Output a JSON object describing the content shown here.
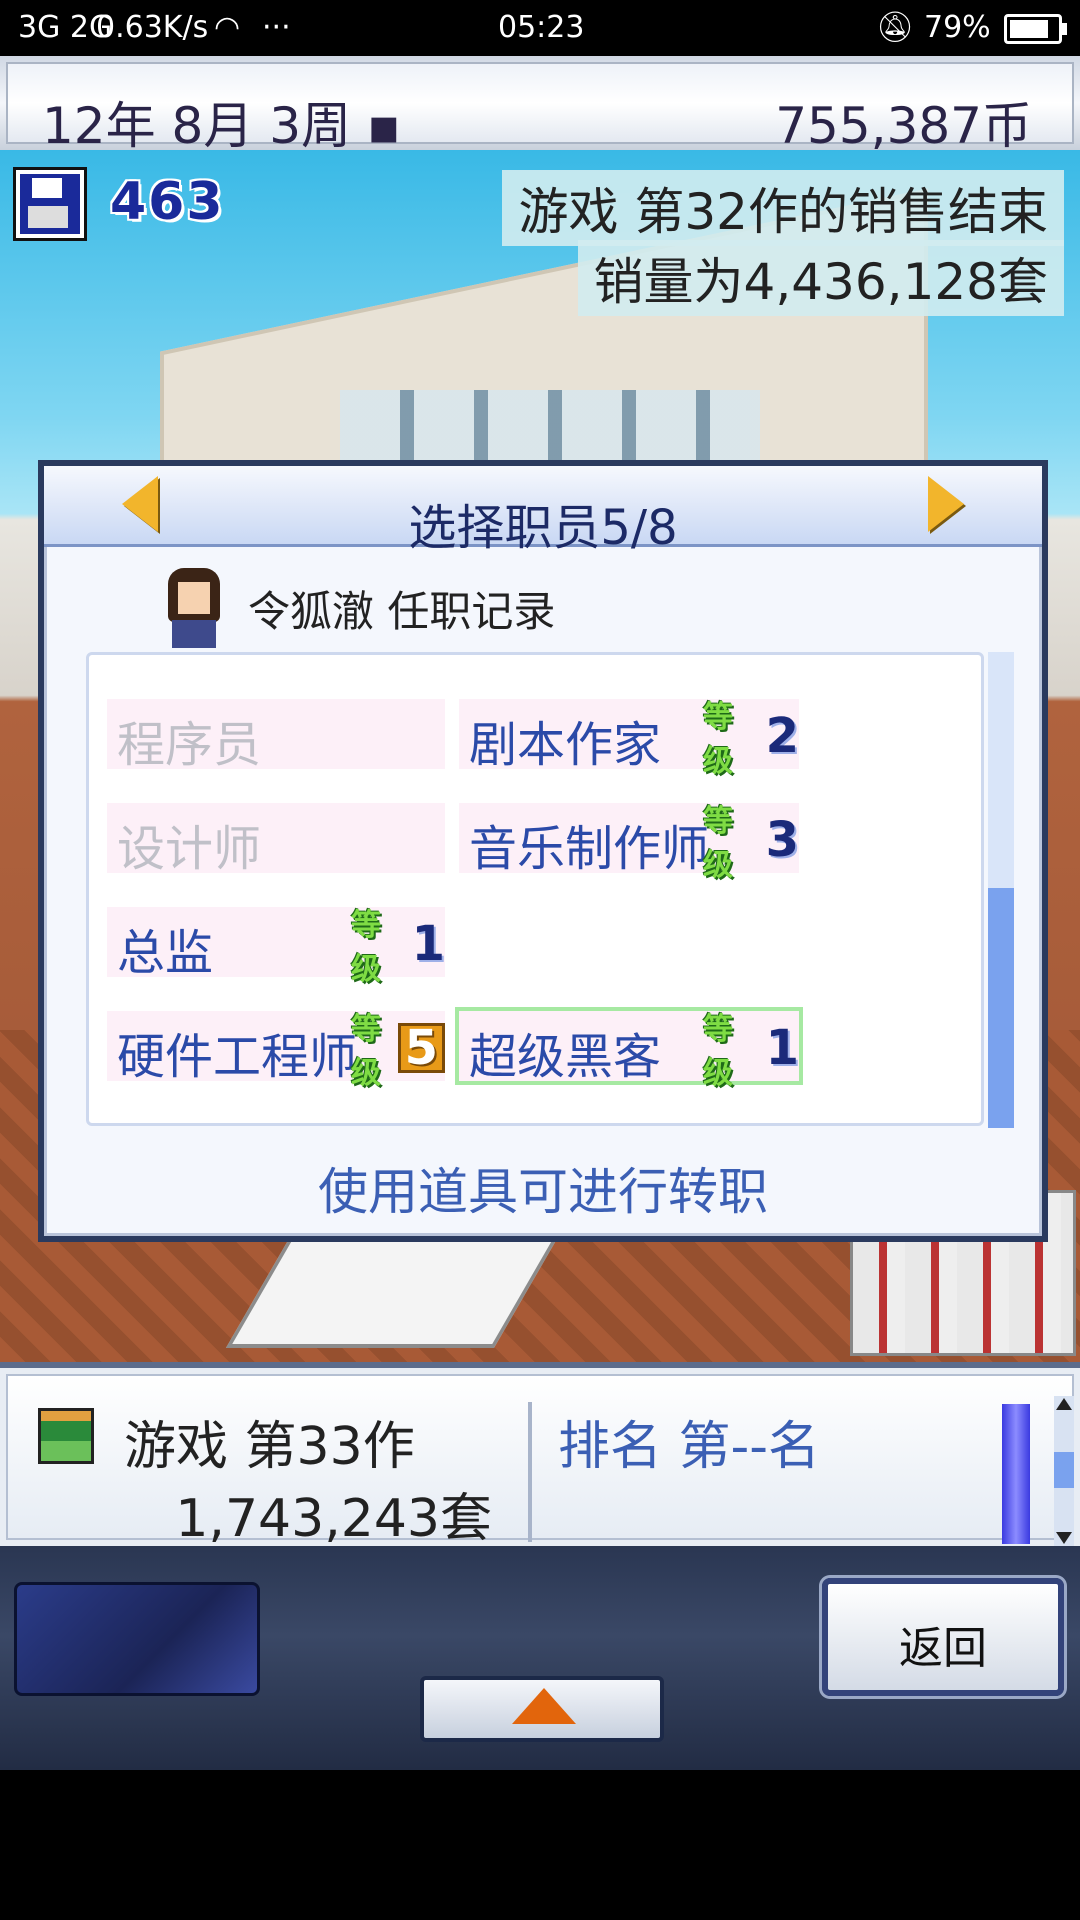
{
  "status_bar": {
    "network": "3G 2G",
    "speed": "0.63K/s",
    "more": "···",
    "time": "05:23",
    "battery": "79%"
  },
  "top_bar": {
    "date": "12年 8月 3周 ▪",
    "money": "755,387币"
  },
  "scene": {
    "save_count": "463",
    "notice_1": "游戏 第32作的销售结束",
    "notice_2": "销量为4,436,128套"
  },
  "dialog": {
    "title": "选择职员5/8",
    "staff_name": "令狐澈 任职记录",
    "level_tag": "等级",
    "jobs": [
      {
        "label": "程序员",
        "unlocked": false,
        "level": ""
      },
      {
        "label": "剧本作家",
        "unlocked": true,
        "level": "2"
      },
      {
        "label": "设计师",
        "unlocked": false,
        "level": ""
      },
      {
        "label": "音乐制作师",
        "unlocked": true,
        "level": "3"
      },
      {
        "label": "总监",
        "unlocked": true,
        "level": "1"
      },
      {
        "label": "硬件工程师",
        "unlocked": true,
        "level": "5"
      },
      {
        "label": "超级黑客",
        "unlocked": true,
        "level": "1",
        "selected": true
      }
    ],
    "hint": "使用道具可进行转职"
  },
  "info_panel": {
    "game_name": "游戏 第33作",
    "game_sales": "1,743,243套",
    "rank": "排名 第--名"
  },
  "controls": {
    "back_label": "返回"
  },
  "colors": {
    "accent_blue": "#3b5fb4",
    "level_green": "#7fdc44",
    "selected_outline": "#a6e9a2",
    "arrow_yellow": "#f2b52c"
  }
}
